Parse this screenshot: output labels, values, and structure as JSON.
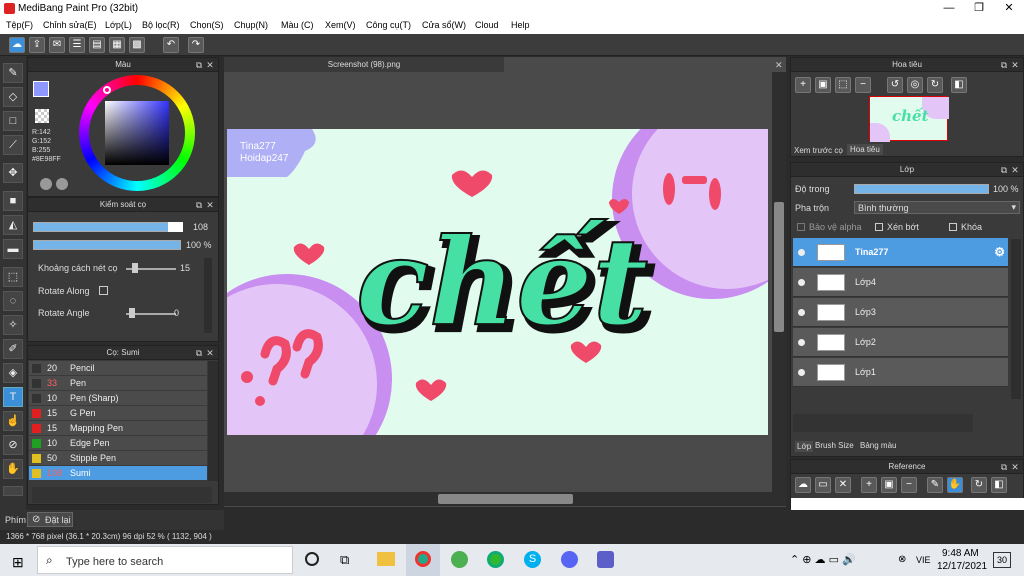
{
  "app": {
    "title": "MediBang Paint Pro (32bit)"
  },
  "menu": [
    "Tệp(F)",
    "Chỉnh sửa(E)",
    "Lớp(L)",
    "Bộ lọc(R)",
    "Chọn(S)",
    "Chụp(N)",
    "Màu (C)",
    "Xem(V)",
    "Công cụ(T)",
    "Cửa sổ(W)",
    "Cloud",
    "Help"
  ],
  "color_panel": {
    "title": "Màu",
    "rgb": [
      "R:142",
      "G:152",
      "B:255"
    ],
    "hex": "#8E98FF"
  },
  "brush_control": {
    "title": "Kiểm soát cọ",
    "size": "108",
    "opacity": "100 %",
    "spacing_label": "Khoảng cách nét cọ",
    "spacing_value": "15",
    "rotate_along": "Rotate Along",
    "rotate_angle": "Rotate Angle",
    "angle_value": "0"
  },
  "brush_list": {
    "title": "Cọ: Sumi",
    "items": [
      {
        "size": "20",
        "name": "Pencil",
        "color": "#333333"
      },
      {
        "size": "33",
        "name": "Pen",
        "color": "#333333"
      },
      {
        "size": "10",
        "name": "Pen (Sharp)",
        "color": "#333333"
      },
      {
        "size": "15",
        "name": "G Pen",
        "color": "#e02020"
      },
      {
        "size": "15",
        "name": "Mapping Pen",
        "color": "#e02020"
      },
      {
        "size": "10",
        "name": "Edge Pen",
        "color": "#20a020"
      },
      {
        "size": "50",
        "name": "Stipple Pen",
        "color": "#e0c020"
      },
      {
        "size": "108",
        "name": "Sumi",
        "color": "#e0c020"
      }
    ]
  },
  "document": {
    "tab": "Screenshot (98).png"
  },
  "artwork": {
    "credit1": "Tina277",
    "credit2": "Hoidap247",
    "word": "chết"
  },
  "navigator": {
    "title": "Hoa tiêu",
    "tabs": [
      "Xem trước cọ",
      "Hoa tiêu"
    ]
  },
  "layers": {
    "title": "Lớp",
    "opacity_label": "Độ trong",
    "opacity": "100 %",
    "blend_label": "Pha trộn",
    "blend": "Bình thường",
    "protect": "Bảo vệ alpha",
    "clip": "Xén bớt",
    "lock": "Khóa",
    "items": [
      "Tina277",
      "Lớp4",
      "Lớp3",
      "Lớp2",
      "Lớp1"
    ],
    "tabs": [
      "Lớp",
      "Brush Size",
      "Bảng màu"
    ]
  },
  "reference": {
    "title": "Reference"
  },
  "bottom": {
    "tab": "Phím",
    "undo": "Đặt lại"
  },
  "status": "1366 * 768 pixel   (36.1 * 20.3cm)   96 dpi   52 %   ( 1132, 904 )",
  "taskbar": {
    "search": "Type here to search",
    "time": "9:48 AM",
    "date": "12/17/2021",
    "lang": "VIE",
    "notif": "30"
  }
}
